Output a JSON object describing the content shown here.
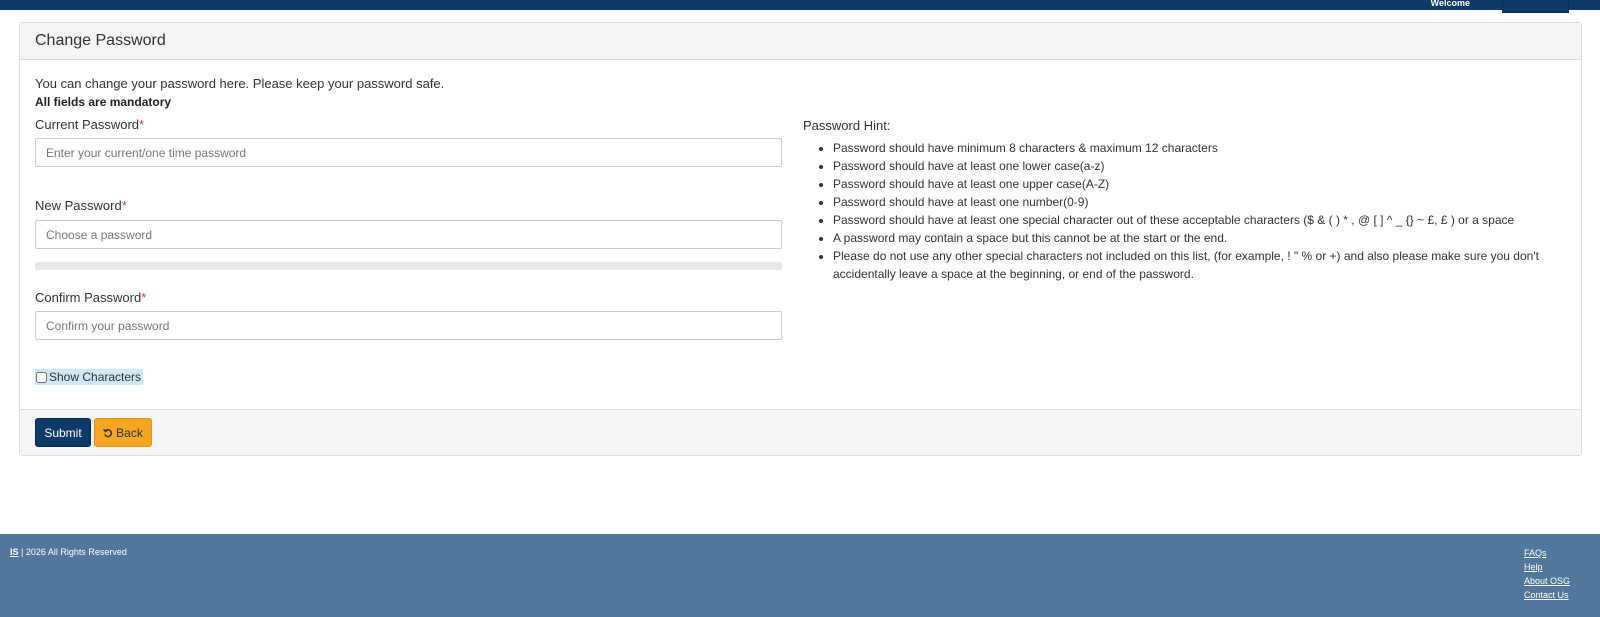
{
  "header": {
    "welcome": "Welcome"
  },
  "panel": {
    "title": "Change Password",
    "intro": "You can change your password here. Please keep your password safe.",
    "mandatory": "All fields are mandatory"
  },
  "fields": {
    "current": {
      "label": "Current Password",
      "required_mark": "*",
      "placeholder": "Enter your current/one time password",
      "value": ""
    },
    "new": {
      "label": "New Password",
      "required_mark": "*",
      "placeholder": "Choose a password",
      "value": ""
    },
    "confirm": {
      "label": "Confirm Password",
      "required_mark": "*",
      "placeholder": "Confirm your password",
      "value": ""
    }
  },
  "show_characters": {
    "label": "Show Characters",
    "checked": false
  },
  "hint": {
    "title": "Password Hint:",
    "items": [
      "Password should have minimum 8 characters & maximum 12 characters",
      "Password should have at least one lower case(a-z)",
      "Password should have at least one upper case(A-Z)",
      "Password should have at least one number(0-9)",
      "Password should have at least one special character out of these acceptable characters ($ & ( ) * , @ [ ] ^ _ {} ~ £, £ ) or a space",
      "A password may contain a space but this cannot be at the start or the end.",
      "Please do not use any other special characters not included on this list, (for example, ! \" % or +) and  also please make sure you don't accidentally leave a space at the beginning, or end of the password."
    ]
  },
  "buttons": {
    "submit": "Submit",
    "back": "Back",
    "back_icon": "undo-icon"
  },
  "footer": {
    "brand": "IS",
    "copyright": " | 2026 All Rights Reserved",
    "links": [
      "FAQs",
      "Help",
      "About OSG",
      "Contact Us"
    ]
  },
  "colors": {
    "primary": "#0d3a66",
    "footer_bg": "#52779c",
    "back_button": "#f5a623",
    "required": "#d9342b"
  }
}
